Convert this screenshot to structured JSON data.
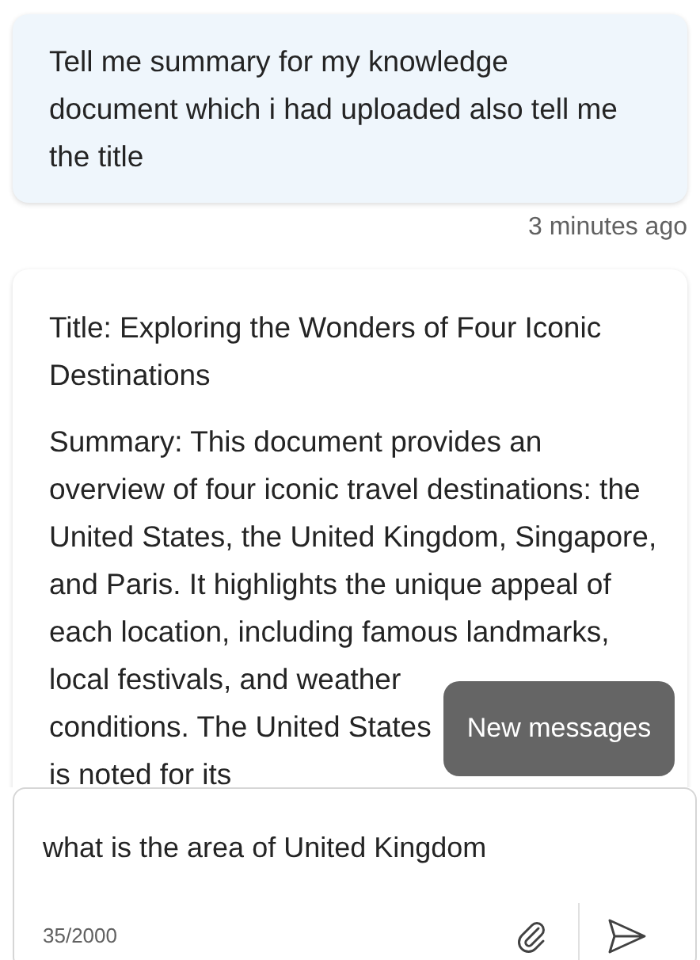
{
  "messages": [
    {
      "kind": "user",
      "text": "Tell me summary for my knowledge document which i had uploaded also tell me the title",
      "time": "3 minutes ago"
    },
    {
      "kind": "bot",
      "paragraphs": [
        {
          "kind": "paragraph",
          "text": "Title: Exploring the Wonders of Four Iconic Destinations"
        },
        {
          "kind": "paragraph",
          "text": "Summary: This document provides an overview of four iconic travel destinations: the United States, the United Kingdom, Singapore, and Paris. It highlights the unique appeal of each location, including famous landmarks,"
        },
        {
          "kind": "continuation",
          "text": "local festivals, and weather conditions. The United States is noted for its"
        }
      ]
    }
  ],
  "new_messages_button": {
    "label": "New messages"
  },
  "composer": {
    "value": "what is the area of United Kingdom",
    "counter": "35/2000"
  }
}
